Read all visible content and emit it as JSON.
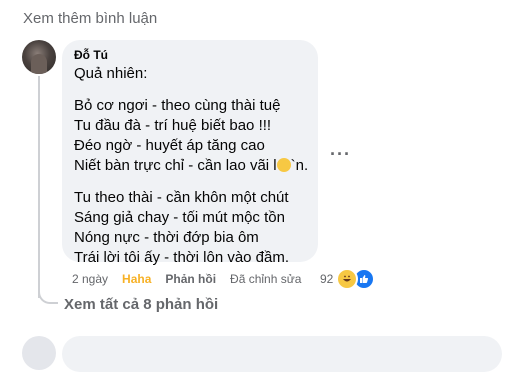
{
  "view_more_label": "Xem thêm bình luận",
  "comment": {
    "author": "Đỗ Tú",
    "lines": [
      "Quả nhiên:",
      "",
      "Bỏ cơ ngơi - theo cùng thài tuệ",
      "Tu đầu đà - trí huệ biết bao !!!",
      "Đéo ngờ - huyết áp tăng cao",
      "Niết bàn trực chỉ - cần lao vãi l",
      "",
      "Tu theo thài - cần khôn một chút",
      "Sáng giả chay - tối mút mộc tồn",
      "Nóng nực - thời đớp bia ôm",
      "Trái lời tôi ấy - thời lôn vào đầm."
    ],
    "line4_suffix": "`n.",
    "time": "2 ngày",
    "reaction_label": "Haha",
    "reply_label": "Phản hồi",
    "edited_label": "Đã chỉnh sửa",
    "reaction_count": "92"
  },
  "see_all_replies": "Xem tất cả 8 phản hồi",
  "icons": {
    "more": "more-dots-icon",
    "haha": "haha-reaction-icon",
    "like": "like-reaction-icon"
  },
  "colors": {
    "haha": "#f7b125",
    "like": "#1877f2",
    "bubble": "#f0f2f5"
  }
}
